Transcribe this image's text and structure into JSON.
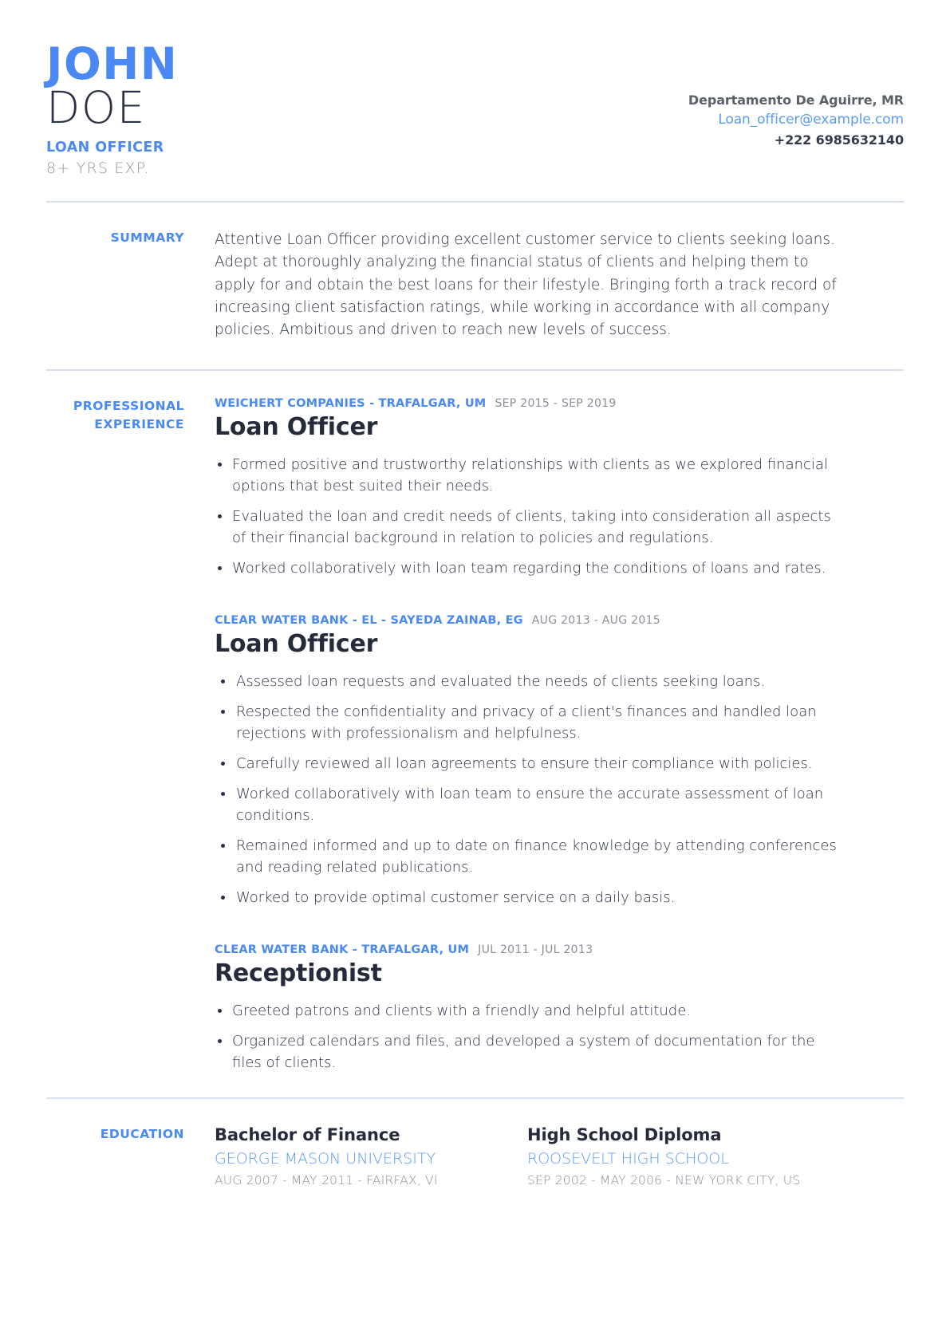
{
  "header": {
    "first_name": "JOHN",
    "last_name": "DOE",
    "job_title": "LOAN OFFICER",
    "years_experience": "8+ YRS EXP.",
    "contact": {
      "address": "Departamento De Aguirre, MR",
      "email": "Loan_officer@example.com",
      "phone": "+222 6985632140"
    }
  },
  "colors": {
    "accent_blue": "#4a89f3",
    "link_blue": "#5c9bf5",
    "dark_text": "#2b3245",
    "muted_gray": "#8a8f99",
    "divider": "#d7dfec"
  },
  "summary": {
    "label": "SUMMARY",
    "text": "Attentive Loan Officer providing excellent customer service to clients seeking loans. Adept at thoroughly analyzing the financial status of clients and helping them to apply for and obtain the best loans for their lifestyle. Bringing forth a track record of increasing client satisfaction ratings, while working in accordance with all company policies. Ambitious and driven to reach new levels of success."
  },
  "experience": {
    "label_line1": "PROFESSIONAL",
    "label_line2": "EXPERIENCE",
    "jobs": [
      {
        "company": "WEICHERT COMPANIES - TRAFALGAR, UM",
        "dates": "SEP 2015 - SEP 2019",
        "title": "Loan Officer",
        "bullets": [
          "Formed positive and trustworthy relationships with clients as we explored financial options that best suited their needs.",
          "Evaluated the loan and credit needs of clients, taking into consideration all aspects of their financial background in relation to policies and regulations.",
          "Worked collaboratively with loan team regarding the conditions of loans and rates."
        ]
      },
      {
        "company": "CLEAR WATER BANK - EL - SAYEDA ZAINAB, EG",
        "dates": "AUG 2013 - AUG 2015",
        "title": "Loan Officer",
        "bullets": [
          "Assessed loan requests and evaluated the needs of clients seeking loans.",
          "Respected the confidentiality and privacy of a client's finances and handled loan   rejections with professionalism and helpfulness.",
          "Carefully reviewed all loan agreements to ensure their compliance with policies.",
          "Worked collaboratively with loan team to ensure the accurate assessment of loan conditions.",
          "Remained informed and up to date on finance knowledge by attending   conferences and reading related publications.",
          "Worked to provide optimal customer service on a daily basis."
        ]
      },
      {
        "company": "CLEAR WATER BANK - TRAFALGAR, UM",
        "dates": "JUL 2011 - JUL 2013",
        "title": "Receptionist",
        "bullets": [
          "Greeted patrons and clients with a friendly and helpful attitude.",
          "Organized calendars and files, and developed a system of documentation for the files of clients."
        ]
      }
    ]
  },
  "education": {
    "label": "EDUCATION",
    "entries": [
      {
        "degree": "Bachelor of Finance",
        "school": "GEORGE MASON UNIVERSITY",
        "dates": "AUG 2007 - MAY 2011 - FAIRFAX, VI"
      },
      {
        "degree": "High School Diploma",
        "school": "ROOSEVELT HIGH SCHOOL",
        "dates": "SEP 2002 - MAY 2006 - NEW YORK CITY, US"
      }
    ]
  }
}
